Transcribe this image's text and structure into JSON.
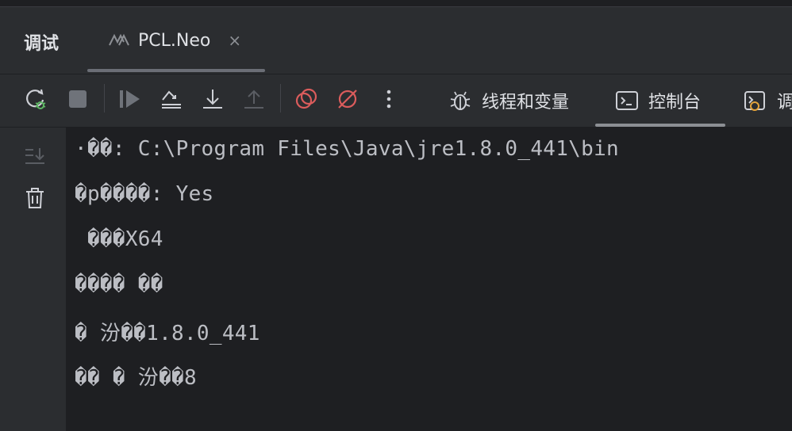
{
  "panel": {
    "title": "调试"
  },
  "tabs": [
    {
      "label": "PCL.Neo",
      "close": "×",
      "icon": "run-config-icon"
    }
  ],
  "toolbar": {
    "buttons": [
      {
        "name": "rerun-debug-icon"
      },
      {
        "name": "stop-icon"
      },
      {
        "name": "resume-icon"
      },
      {
        "name": "step-over-icon"
      },
      {
        "name": "step-into-icon"
      },
      {
        "name": "step-out-icon"
      },
      {
        "name": "view-breakpoints-icon"
      },
      {
        "name": "mute-breakpoints-icon"
      },
      {
        "name": "more-options-icon"
      }
    ],
    "view_tabs": [
      {
        "label": "线程和变量",
        "icon": "bug-icon"
      },
      {
        "label": "控制台",
        "icon": "console-icon",
        "selected": true
      },
      {
        "label": "调",
        "icon": "debug-console-icon"
      }
    ]
  },
  "gutter": {
    "buttons": [
      {
        "name": "scroll-to-end-icon"
      },
      {
        "name": "clear-all-icon"
      }
    ]
  },
  "console": {
    "lines": [
      "·��: C:\\Program Files\\Java\\jre1.8.0_441\\bin",
      "�p����: Yes",
      " ���X64",
      "���� ��",
      "� 汾��1.8.0_441",
      "�� � 汾��8"
    ]
  },
  "colors": {
    "background": "#2b2d30",
    "console_bg": "#1e1f22",
    "text": "#bcbec4",
    "accent_red": "#db5c5c",
    "accent_green": "#5fb865"
  }
}
